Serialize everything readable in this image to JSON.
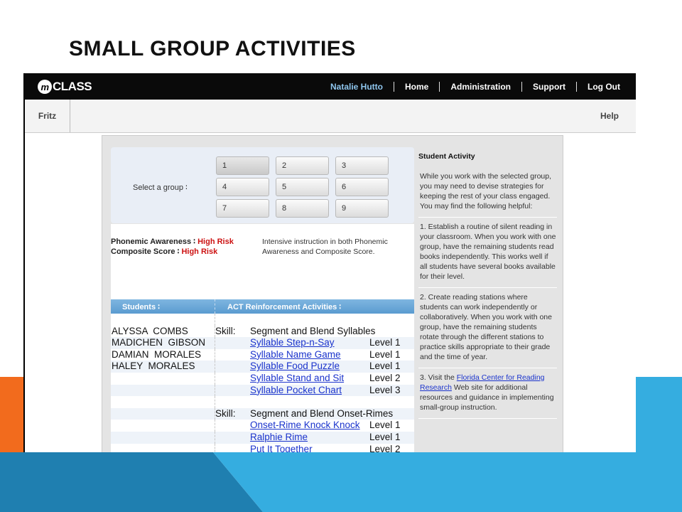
{
  "slide": {
    "title": "SMALL GROUP ACTIVITIES"
  },
  "colors": {
    "orange": "#f26b1d",
    "light_blue": "#35ade0",
    "dark_blue": "#1f7fb0",
    "header_blue": "#5a9bd0",
    "risk_red": "#cc1111",
    "link_blue": "#1a33cc"
  },
  "app": {
    "logo_mark": "m",
    "logo_text": "CLASS",
    "nav": [
      "Natalie Hutto",
      "Home",
      "Administration",
      "Support",
      "Log Out"
    ],
    "student_tab": "Fritz",
    "help": "Help"
  },
  "groups": {
    "label": "Select a group ∶",
    "buttons": [
      "1",
      "2",
      "3",
      "4",
      "5",
      "6",
      "7",
      "8",
      "9"
    ],
    "selected": "1"
  },
  "risk": {
    "pa_label": "Phonemic Awareness ∶",
    "pa_value": "High Risk",
    "cs_label": "Composite Score ∶",
    "cs_value": "High Risk",
    "description": "Intensive instruction in both Phonemic Awareness and Composite Score."
  },
  "table": {
    "col_students": "Students ∶",
    "col_activities": "ACT Reinforcement Activities ∶",
    "students": [
      "ALYSSA  COMBS",
      "MADICHEN  GIBSON",
      "DAMIAN  MORALES",
      "HALEY  MORALES"
    ],
    "skill_label": "Skill:",
    "skills": [
      {
        "name": "Segment and Blend Syllables",
        "activities": [
          {
            "name": "Syllable Step-n-Say",
            "level": "Level 1"
          },
          {
            "name": "Syllable Name Game",
            "level": "Level 1"
          },
          {
            "name": "Syllable Food Puzzle",
            "level": "Level 1"
          },
          {
            "name": "Syllable Stand and Sit",
            "level": "Level 2"
          },
          {
            "name": "Syllable Pocket Chart",
            "level": "Level 3"
          }
        ]
      },
      {
        "name": "Segment and Blend Onset-Rimes",
        "activities": [
          {
            "name": "Onset-Rime Knock Knock",
            "level": "Level 1"
          },
          {
            "name": "Ralphie Rime",
            "level": "Level 1"
          },
          {
            "name": "Put It Together",
            "level": "Level 2"
          }
        ]
      }
    ]
  },
  "sidebar": {
    "heading": "Student Activity",
    "intro": "While you work with the selected group, you may need to devise strategies for keeping the rest of your class engaged. You may find the following helpful:",
    "tip1": "1. Establish a routine of silent reading in your classroom. When you work with one group, have the remaining students read books independently. This works well if all students have several books available for their level.",
    "tip2": "2. Create reading stations where students can work independently or collaboratively. When you work with one group, have the remaining students rotate through the different stations to practice skills appropriate to their grade and the time of year.",
    "tip3_prefix": "3. Visit the ",
    "tip3_link": "Florida Center for Reading Research",
    "tip3_suffix": " Web site for additional resources and guidance in implementing small-group instruction."
  }
}
